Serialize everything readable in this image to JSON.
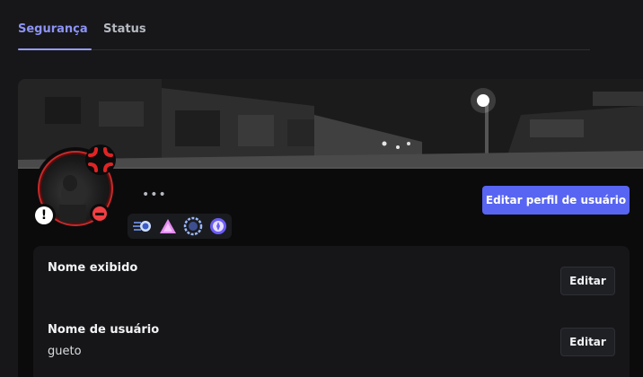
{
  "tabs": [
    {
      "label": "Segurança",
      "active": true
    },
    {
      "label": "Status",
      "active": false
    }
  ],
  "profile": {
    "edit_profile_label": "Editar perfil de usuário",
    "more_glyph": "•••",
    "alert_glyph": "!",
    "status": "do-not-disturb",
    "badges": [
      "hypesquad-balance-icon",
      "nitro-triangle-icon",
      "boost-gem-icon",
      "quest-badge-icon"
    ]
  },
  "fields": [
    {
      "label": "Nome exibido",
      "value": "",
      "button": "Editar"
    },
    {
      "label": "Nome de usuário",
      "value": "gueto",
      "button": "Editar"
    }
  ],
  "colors": {
    "accent": "#5865f2",
    "tab_active": "#949cf7",
    "dnd": "#f23f43",
    "avatar_ring": "#c62a2a"
  }
}
